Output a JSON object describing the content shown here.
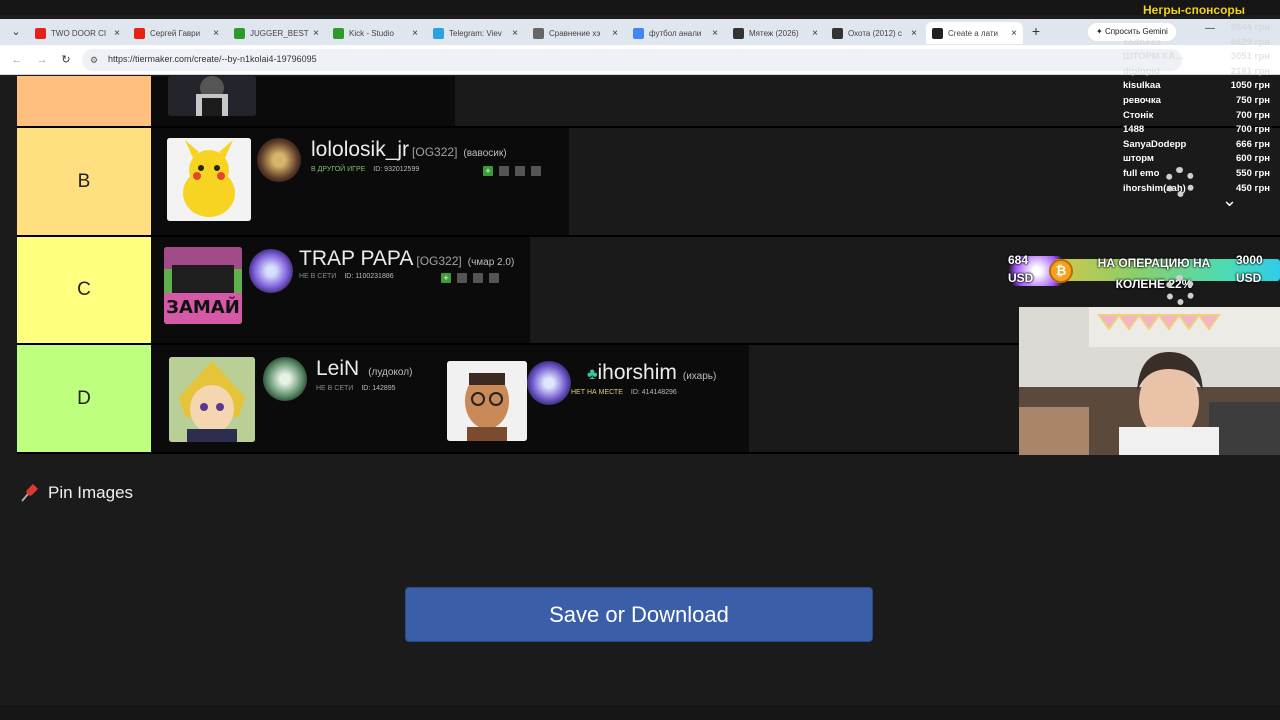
{
  "browser": {
    "tabs": [
      {
        "title": "TWO DOOR CI",
        "icon": "youtube-icon",
        "color": "#e62117"
      },
      {
        "title": "Сергей Гаври",
        "icon": "youtube-icon",
        "color": "#e62117"
      },
      {
        "title": "JUGGER_BEST",
        "icon": "kick-icon",
        "color": "#2c9b2c"
      },
      {
        "title": "Kick - Studio",
        "icon": "kick-icon",
        "color": "#2c9b2c"
      },
      {
        "title": "Telegram: Viev",
        "icon": "telegram-icon",
        "color": "#2aa3de"
      },
      {
        "title": "Сравнение хэ",
        "icon": "globe-icon",
        "color": "#666666"
      },
      {
        "title": "футбол анали",
        "icon": "google-icon",
        "color": "#4285f4"
      },
      {
        "title": "Мятеж (2026)",
        "icon": "site-icon",
        "color": "#333333"
      },
      {
        "title": "Охота (2012) с",
        "icon": "site-icon",
        "color": "#333333"
      },
      {
        "title": "Create a лати",
        "icon": "tiermaker-icon",
        "color": "#222222"
      }
    ],
    "active_tab_index": 9,
    "gemini_label": "Спросить Gemini",
    "url": "https://tiermaker.com/create/--by-n1kolai4-19796095"
  },
  "tiers": [
    {
      "label": "",
      "color": "#ffbf7f"
    },
    {
      "label": "B",
      "color": "#ffdf7f",
      "cards": [
        {
          "name": "lololosik_jr",
          "team": "[OG322]",
          "nick": "(вавосик)",
          "status": "В ДРУГОЙ ИГРЕ",
          "status_type": "game",
          "id": "ID: 932012599"
        }
      ]
    },
    {
      "label": "C",
      "color": "#ffff7f",
      "cards": [
        {
          "name": "TRAP PAPA",
          "team": "[OG322]",
          "nick": "(чмар 2.0)",
          "status": "НЕ В СЕТИ",
          "status_type": "offline",
          "id": "ID: 1100231886",
          "pic_text": "ЗАМАЙ"
        }
      ]
    },
    {
      "label": "D",
      "color": "#bfff7f",
      "cards": [
        {
          "name": "LeiN",
          "team": "",
          "nick": "(лудокол)",
          "status": "НЕ В СЕТИ",
          "status_type": "offline",
          "id": "ID: 142895"
        },
        {
          "name": "ihorshim",
          "team": "",
          "nick": "(ихарь)",
          "status": "НЕТ НА МЕСТЕ",
          "status_type": "away",
          "id": "ID: 414148296"
        }
      ]
    }
  ],
  "pin_label": "Pin Images",
  "save_label": "Save or Download",
  "overlay": {
    "donors_title": "Негры-спонсоры",
    "donors": [
      {
        "name": "",
        "amount": "8844 грн"
      },
      {
        "name": "sadness",
        "amount": "6629 грн"
      },
      {
        "name": "ШТОРМ КА...",
        "amount": "3051 грн"
      },
      {
        "name": "diplopid",
        "amount": "2181 грн"
      },
      {
        "name": "kisulkaa",
        "amount": "1050 грн"
      },
      {
        "name": "ревочка",
        "amount": "750 грн"
      },
      {
        "name": "Стонік",
        "amount": "700 грн"
      },
      {
        "name": "1488",
        "amount": "700 грн"
      },
      {
        "name": "SanyaDodepp",
        "amount": "666 грн"
      },
      {
        "name": "шторм",
        "amount": "600 грн"
      },
      {
        "name": "full emo",
        "amount": "550 грн"
      },
      {
        "name": "ihorshim(ааh)",
        "amount": "450 грн"
      }
    ],
    "goal": {
      "title": "НА ОПЕРАЦИЮ НА КОЛЕНЕ 22%",
      "current": "684",
      "target": "3000",
      "currency": "USD",
      "progress": 0.22
    }
  }
}
